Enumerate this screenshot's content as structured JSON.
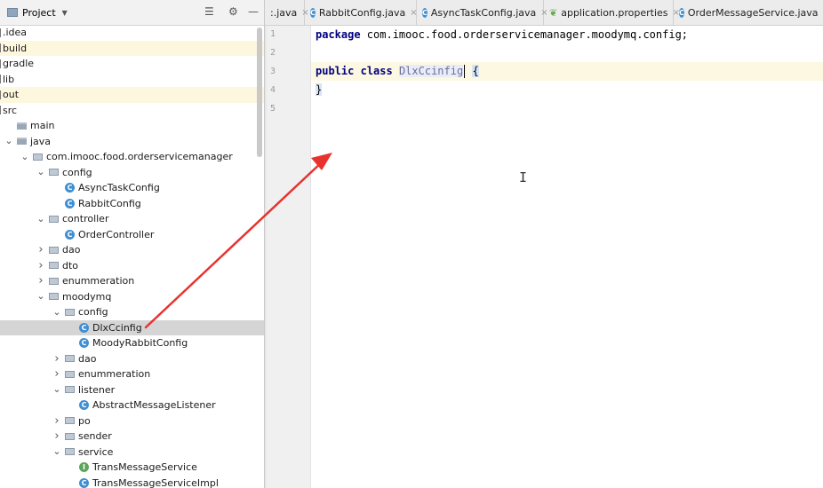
{
  "project_panel": {
    "title": "Project",
    "tree": [
      {
        "label": ".idea",
        "kind": "plain",
        "indent": 0,
        "arrow": "",
        "highlight": ""
      },
      {
        "label": "build",
        "kind": "plain",
        "indent": 0,
        "arrow": "",
        "highlight": "yellow"
      },
      {
        "label": "gradle",
        "kind": "plain",
        "indent": 0,
        "arrow": "",
        "highlight": ""
      },
      {
        "label": "lib",
        "kind": "plain",
        "indent": 0,
        "arrow": "",
        "highlight": ""
      },
      {
        "label": "out",
        "kind": "plain",
        "indent": 0,
        "arrow": "",
        "highlight": "yellow"
      },
      {
        "label": "src",
        "kind": "plain",
        "indent": 0,
        "arrow": "",
        "highlight": ""
      },
      {
        "label": "main",
        "kind": "folder",
        "indent": 1,
        "arrow": "",
        "highlight": ""
      },
      {
        "label": "java",
        "kind": "folder",
        "indent": 1,
        "arrow": "down",
        "highlight": ""
      },
      {
        "label": "com.imooc.food.orderservicemanager",
        "kind": "package",
        "indent": 2,
        "arrow": "down",
        "highlight": ""
      },
      {
        "label": "config",
        "kind": "package",
        "indent": 3,
        "arrow": "down",
        "highlight": ""
      },
      {
        "label": "AsyncTaskConfig",
        "kind": "class",
        "indent": 4,
        "arrow": "",
        "highlight": ""
      },
      {
        "label": "RabbitConfig",
        "kind": "class",
        "indent": 4,
        "arrow": "",
        "highlight": ""
      },
      {
        "label": "controller",
        "kind": "package",
        "indent": 3,
        "arrow": "down",
        "highlight": ""
      },
      {
        "label": "OrderController",
        "kind": "class",
        "indent": 4,
        "arrow": "",
        "highlight": ""
      },
      {
        "label": "dao",
        "kind": "package",
        "indent": 3,
        "arrow": "right",
        "highlight": ""
      },
      {
        "label": "dto",
        "kind": "package",
        "indent": 3,
        "arrow": "right",
        "highlight": ""
      },
      {
        "label": "enummeration",
        "kind": "package",
        "indent": 3,
        "arrow": "right",
        "highlight": ""
      },
      {
        "label": "moodymq",
        "kind": "package",
        "indent": 3,
        "arrow": "down",
        "highlight": ""
      },
      {
        "label": "config",
        "kind": "package",
        "indent": 4,
        "arrow": "down",
        "highlight": ""
      },
      {
        "label": "DlxCcinfig",
        "kind": "class",
        "indent": 5,
        "arrow": "",
        "highlight": "selected"
      },
      {
        "label": "MoodyRabbitConfig",
        "kind": "class",
        "indent": 5,
        "arrow": "",
        "highlight": ""
      },
      {
        "label": "dao",
        "kind": "package",
        "indent": 4,
        "arrow": "right",
        "highlight": ""
      },
      {
        "label": "enummeration",
        "kind": "package",
        "indent": 4,
        "arrow": "right",
        "highlight": ""
      },
      {
        "label": "listener",
        "kind": "package",
        "indent": 4,
        "arrow": "down",
        "highlight": ""
      },
      {
        "label": "AbstractMessageListener",
        "kind": "class",
        "indent": 5,
        "arrow": "",
        "highlight": ""
      },
      {
        "label": "po",
        "kind": "package",
        "indent": 4,
        "arrow": "right",
        "highlight": ""
      },
      {
        "label": "sender",
        "kind": "package",
        "indent": 4,
        "arrow": "right",
        "highlight": ""
      },
      {
        "label": "service",
        "kind": "package",
        "indent": 4,
        "arrow": "down",
        "highlight": ""
      },
      {
        "label": "TransMessageService",
        "kind": "interface",
        "indent": 5,
        "arrow": "",
        "highlight": ""
      },
      {
        "label": "TransMessageServiceImpl",
        "kind": "class",
        "indent": 5,
        "arrow": "",
        "highlight": ""
      }
    ]
  },
  "tabs": [
    {
      "label": ":.java",
      "icon": "none"
    },
    {
      "label": "RabbitConfig.java",
      "icon": "class"
    },
    {
      "label": "AsyncTaskConfig.java",
      "icon": "class"
    },
    {
      "label": "application.properties",
      "icon": "leaf"
    },
    {
      "label": "OrderMessageService.java",
      "icon": "class"
    }
  ],
  "editor": {
    "line_numbers": [
      "1",
      "2",
      "3",
      "4",
      "5"
    ],
    "line1_keyword": "package",
    "line1_rest": " com.imooc.food.orderservicemanager.moodymq.config;",
    "line3_kw1": "public",
    "line3_kw2": "class",
    "line3_classname": "DlxCcinfig",
    "line3_brace": "{",
    "line4_brace": "}"
  },
  "colors": {
    "keyword": "#000080",
    "annotation_arrow": "#e8322e",
    "selected_row": "#d5d5d5",
    "ignored_row": "#fdf7dd"
  }
}
